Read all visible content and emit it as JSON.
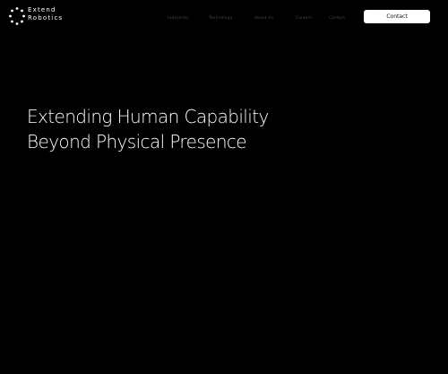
{
  "brand": {
    "name_line1": "Extend",
    "name_line2": "Robotics",
    "logo_icon": "dotted-circle-logo-icon"
  },
  "nav": {
    "items": [
      {
        "label": "Industries"
      },
      {
        "label": "Technology"
      },
      {
        "label": "About Us"
      },
      {
        "label": "Careers"
      },
      {
        "label": "Contact"
      }
    ],
    "contact_button": "Contact"
  },
  "hero": {
    "line1": "Extending Human Capability",
    "line2": "Beyond Physical Presence"
  },
  "colors": {
    "background": "#000000",
    "text": "#ffffff",
    "nav_text": "#4a4a4a",
    "button_bg": "#ffffff",
    "button_text": "#111111"
  }
}
